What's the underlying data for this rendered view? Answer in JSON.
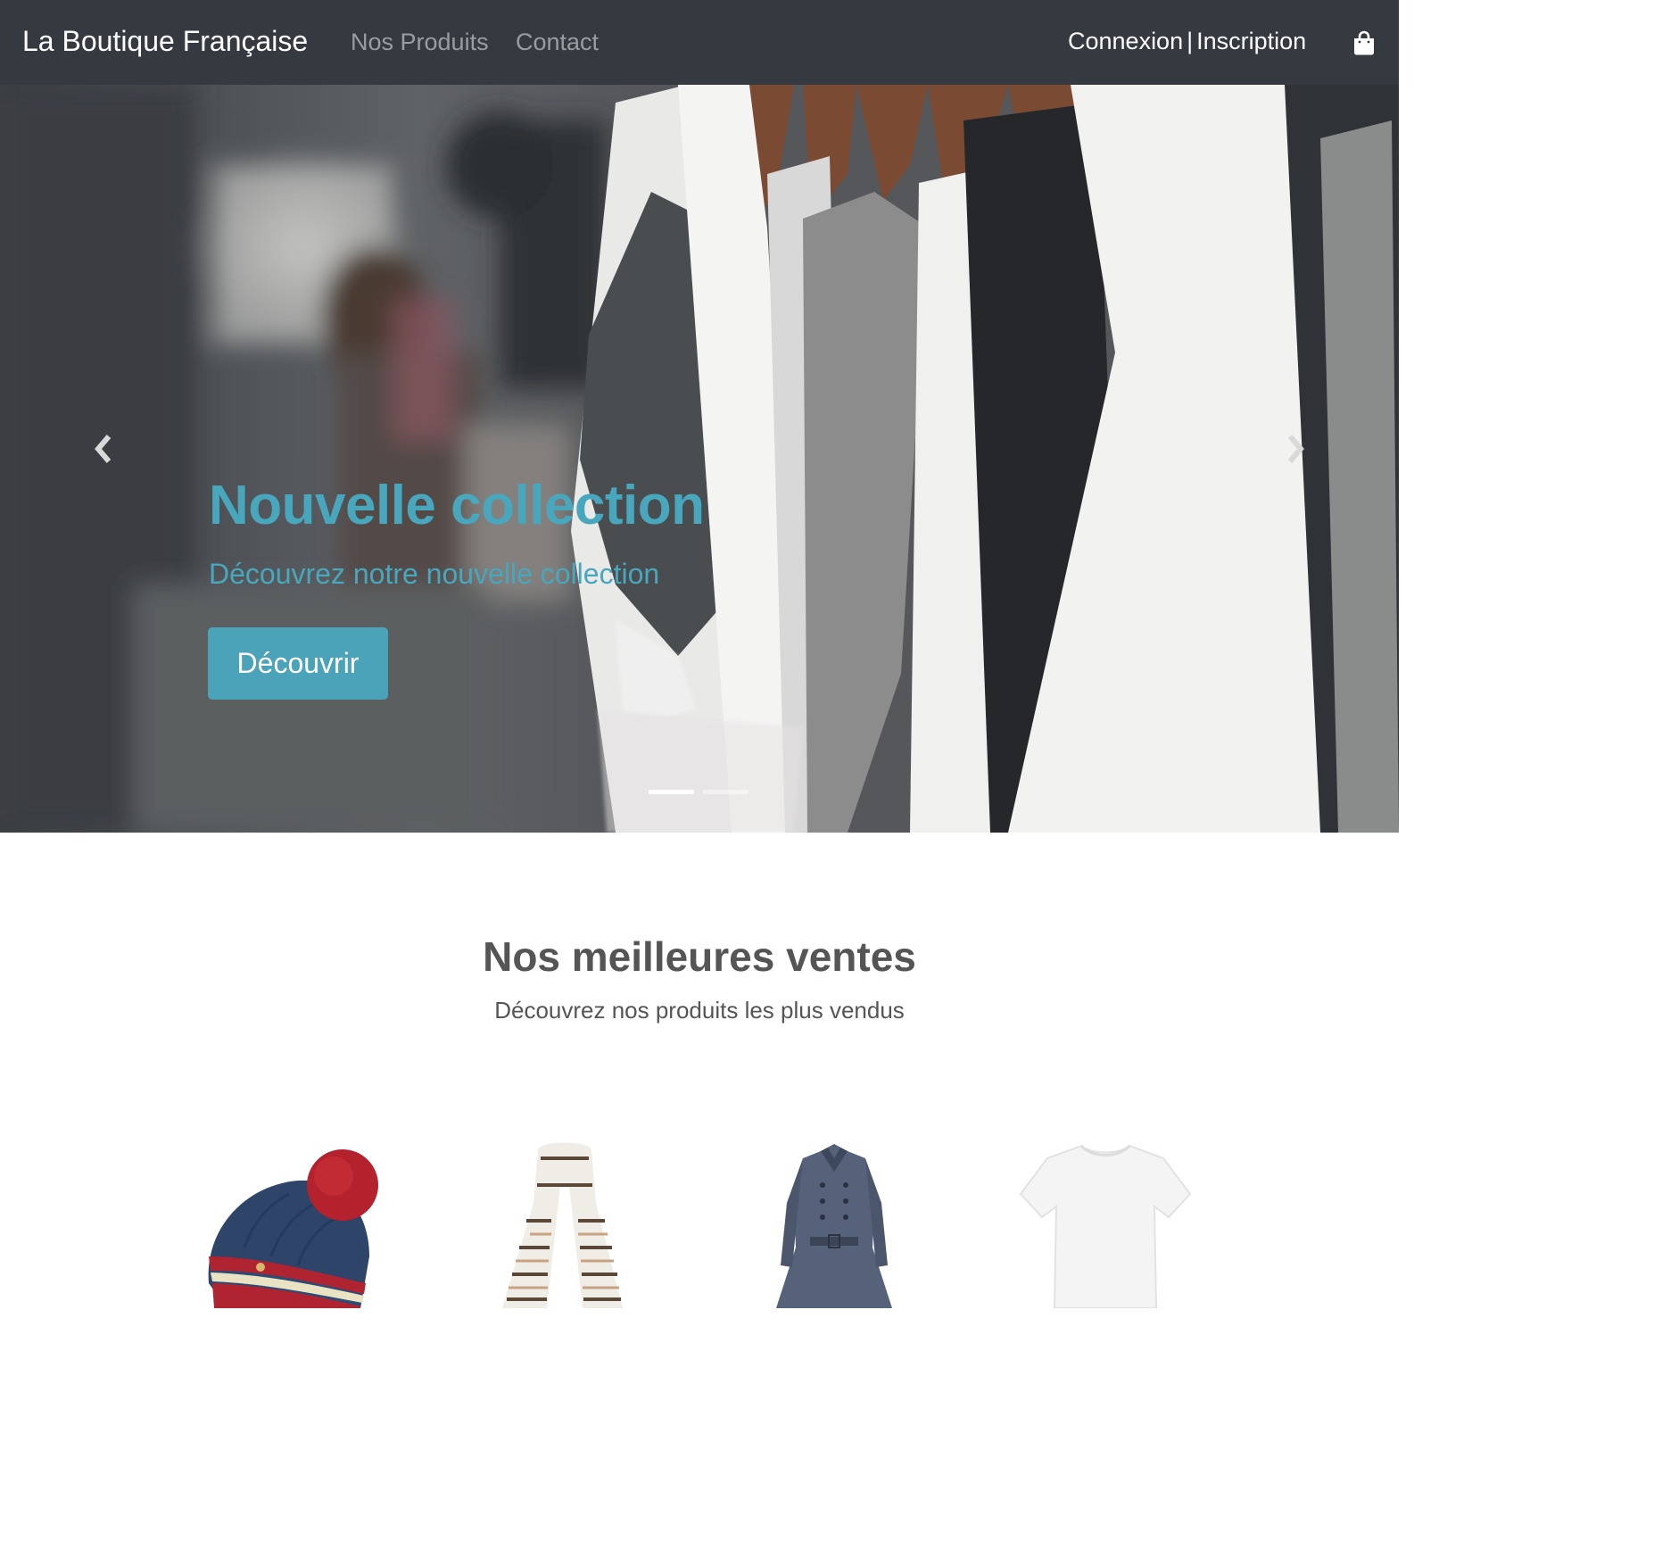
{
  "navbar": {
    "brand": "La Boutique Française",
    "links": [
      "Nos Produits",
      "Contact"
    ],
    "login": "Connexion",
    "separator": "|",
    "register": "Inscription",
    "cart_icon": "shopping-bag-icon"
  },
  "hero": {
    "title": "Nouvelle collection",
    "subtitle": "Découvrez notre nouvelle collection",
    "button": "Découvrir",
    "slide_count": 2,
    "active_slide": 1
  },
  "bestsellers": {
    "title": "Nos meilleures ventes",
    "subtitle": "Découvrez nos produits les plus vendus",
    "products": [
      {
        "icon": "beanie-hat-icon"
      },
      {
        "icon": "scarf-icon"
      },
      {
        "icon": "coat-icon"
      },
      {
        "icon": "tshirt-icon"
      }
    ]
  },
  "colors": {
    "navbar": "#343a40",
    "accent": "#4aa3b9",
    "heading": "#555555"
  }
}
